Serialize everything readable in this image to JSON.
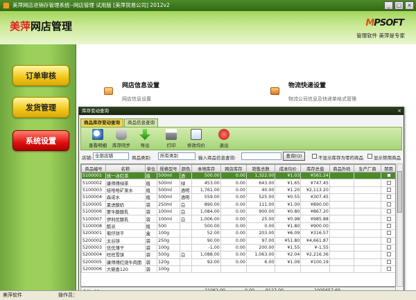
{
  "window": {
    "title": "美萍网店进销存管理系统--网店管理 试用版 [美萍贸易公司] 2012v2"
  },
  "banner": {
    "brand_prefix": "美萍",
    "brand_suffix": "网店管理",
    "logo_mark": "M",
    "logo_rest": "PSOFT",
    "slogan": "管理软件 美萍是专家"
  },
  "sidebar": {
    "items": [
      {
        "label": "订单审核"
      },
      {
        "label": "发货管理"
      },
      {
        "label": "系统设置"
      }
    ]
  },
  "content": {
    "sections": [
      {
        "title": "网店信息设置",
        "subtitle": "网店信息设置"
      },
      {
        "title": "物流快递设置",
        "subtitle": "物流公司信息及快递单格式管理"
      }
    ]
  },
  "dialog": {
    "title": "库存变动查询",
    "close": "×",
    "tabs": [
      {
        "label": "商品库存变动查询"
      },
      {
        "label": "商品信息查询"
      }
    ],
    "toolbar": [
      {
        "label": "查看明细"
      },
      {
        "label": "库存同步"
      },
      {
        "label": "导出"
      },
      {
        "label": "打印"
      },
      {
        "label": "修改均价"
      },
      {
        "label": "退出"
      }
    ],
    "filters": {
      "store_label": "店铺:",
      "store_value": "全部店铺",
      "category_label": "商品类别:",
      "category_value": "所有类别",
      "query_label": "输入商品信息查询:",
      "query_value": "",
      "query_button": "查询(Q)",
      "hide_zero_label": "不显示库存为零的商品",
      "show_disabled_label": "显示禁用商品"
    },
    "columns": [
      "商品编号",
      "名称",
      "单位",
      "规格型号",
      "颜色",
      "本地库存",
      "网店库存",
      "销售总数",
      "成本均价",
      "库存总值",
      "商品外码",
      "生产厂商",
      "禁用"
    ],
    "rows": [
      [
        "5100001",
        "统一冰红茶",
        "瓶",
        "500ml",
        "透",
        "500.00",
        "0.00",
        "1,322.00",
        "¥1.03",
        "¥561.24",
        "",
        "",
        ""
      ],
      [
        "5100002",
        "康师傅绿茶",
        "瓶",
        "500ml",
        "绿",
        "453.00",
        "0.00",
        "643.00",
        "¥1.65",
        "¥747.45",
        "",
        "",
        ""
      ],
      [
        "5100003",
        "娃哈哈矿泉水",
        "瓶",
        "500ml",
        "透明",
        "1,761.00",
        "0.00",
        "40.00",
        "¥1.20",
        "¥2,113.20",
        "",
        "",
        ""
      ],
      [
        "5100004",
        "森诺水",
        "瓶",
        "500ml",
        "透明",
        "559.00",
        "0.00",
        "525.00",
        "¥0.55",
        "¥307.45",
        "",
        "",
        ""
      ],
      [
        "5100005",
        "夏进酸奶",
        "袋",
        "250ml",
        "白",
        "890.00",
        "0.00",
        "111.00",
        "¥1.00",
        "¥890.00",
        "",
        "",
        ""
      ],
      [
        "5100006",
        "蒙牛酸酸乳",
        "袋",
        "100ml",
        "白",
        "1,084.00",
        "0.00",
        "900.00",
        "¥0.80",
        "¥867.20",
        "",
        "",
        ""
      ],
      [
        "5100007",
        "伊利优酸乳",
        "袋",
        "100ml",
        "白",
        "1,006.00",
        "0.00",
        "25.00",
        "¥0.98",
        "¥985.88",
        "",
        "",
        ""
      ],
      [
        "5100008",
        "酷派",
        "瓶",
        "500",
        "",
        "500.00",
        "0.00",
        "0.00",
        "¥1.80",
        "¥900.00",
        "",
        "",
        ""
      ],
      [
        "5200001",
        "葡仔饼干",
        "盒",
        "100g",
        "",
        "52.00",
        "0.00",
        "203.00",
        "¥6.09",
        "¥316.57",
        "",
        "",
        ""
      ],
      [
        "5200002",
        "太谷饼",
        "袋",
        "250g",
        "",
        "90.00",
        "0.00",
        "97.00",
        "¥51.80",
        "¥4,661.87",
        "",
        "",
        ""
      ],
      [
        "5200003",
        "优优薄干",
        "袋",
        "100g",
        "",
        "-1.00",
        "0.00",
        "200.00",
        "¥1.55",
        "¥-1.55",
        "",
        "",
        ""
      ],
      [
        "5200004",
        "旺旺雪饼",
        "袋",
        "500g",
        "白",
        "1,088.00",
        "0.00",
        "1,063.00",
        "¥2.04",
        "¥2,216.36",
        "",
        "",
        ""
      ],
      [
        "5200005",
        "康师傅红烧牛肉面",
        "袋",
        "120g",
        "",
        "92.00",
        "0.00",
        "6.00",
        "¥1.09",
        "¥100.19",
        "",
        "",
        ""
      ],
      [
        "5200006",
        "大碗香120",
        "袋",
        "100g",
        "",
        "",
        "",
        "",
        "",
        "",
        "",
        "",
        ""
      ]
    ],
    "totals": {
      "label": "合计: 33",
      "local": "21062.00",
      "online": "0.00",
      "sales": "9127.00",
      "value": "1005657.69"
    }
  },
  "statusbar": {
    "app": "美萍软件",
    "operator": "操作员："
  }
}
